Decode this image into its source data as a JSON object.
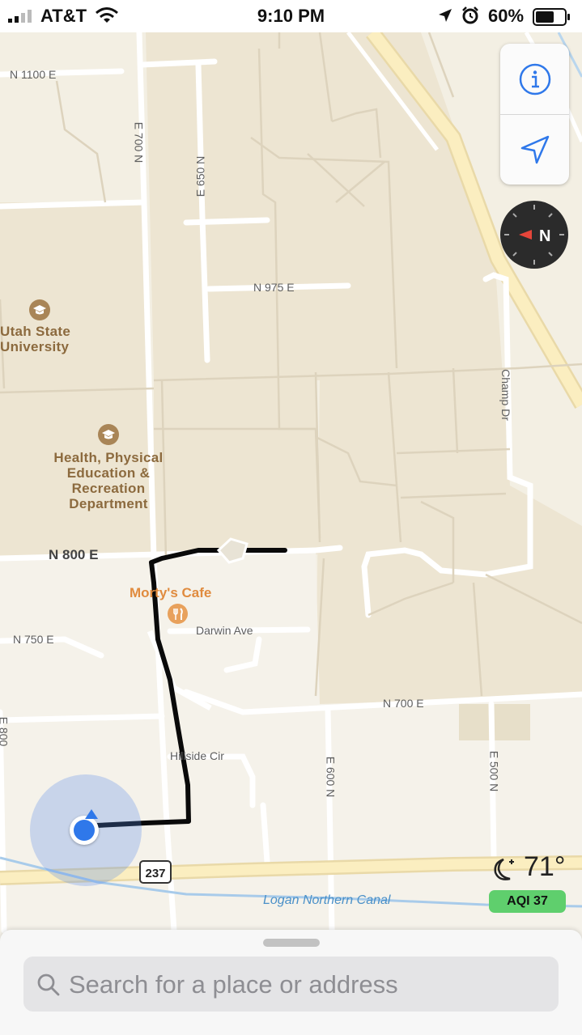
{
  "status_bar": {
    "carrier": "AT&T",
    "time": "9:10 PM",
    "battery": "60%"
  },
  "map": {
    "places": [
      {
        "name": "Utah State University"
      },
      {
        "name": "Health, Physical Education & Recreation Department"
      }
    ],
    "place_lines": {
      "usu": [
        "Utah State",
        "University"
      ],
      "hper": [
        "Health, Physical",
        "Education &",
        "Recreation",
        "Department"
      ]
    },
    "roads": {
      "n1100e": "N 1100 E",
      "e700n": "E 700 N",
      "e650n": "E 650 N",
      "n975e": "N 975 E",
      "champ": "Champ Dr",
      "n800e": "N 800 E",
      "darwin": "Darwin Ave",
      "n750e": "N 750 E",
      "n700e": "N 700 E",
      "hillside": "Hillside Cir",
      "e600n": "E 600 N",
      "e500n": "E 500 N",
      "e800n_partial": "E 800"
    },
    "poi": {
      "cafe": "Morty's Cafe"
    },
    "route_shield": "237",
    "canal": "Logan Northern Canal",
    "icons": [
      "graduation-cap-icon",
      "fork-knife-icon"
    ]
  },
  "controls": {
    "info_icon": "info-icon",
    "location_icon": "location-arrow-icon",
    "compass_letter": "N"
  },
  "weather": {
    "temperature": "71°",
    "condition_icon": "moon-stars-icon",
    "aqi": "AQI 37",
    "aqi_color": "#5fcf6d"
  },
  "search": {
    "placeholder": "Search for a place or address"
  },
  "colors": {
    "accent": "#2f78ea",
    "land": "#f3efe3",
    "highway": "#f9e6a8"
  }
}
